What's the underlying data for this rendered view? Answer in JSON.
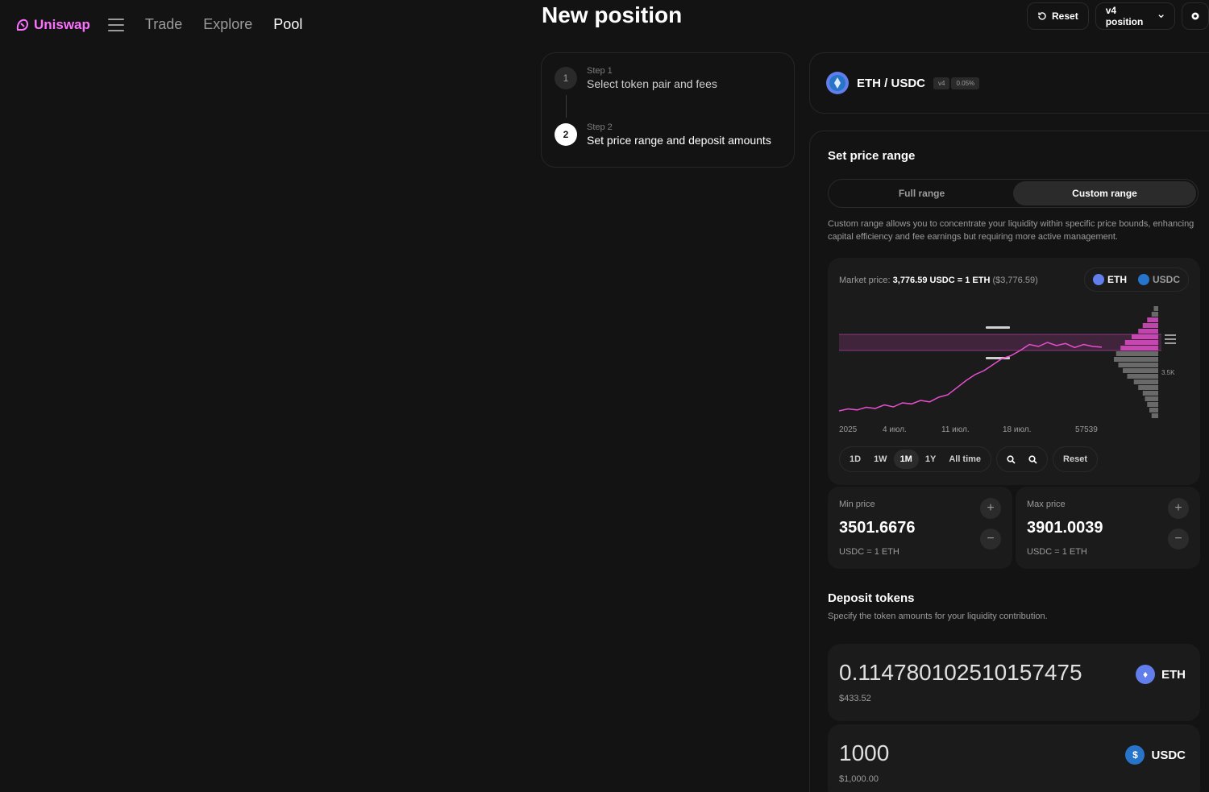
{
  "nav": {
    "brand": "Uniswap",
    "links": [
      "Trade",
      "Explore",
      "Pool"
    ],
    "active": "Pool"
  },
  "page": {
    "title": "New position"
  },
  "actions": {
    "reset": "Reset",
    "version": "v4 position"
  },
  "steps": [
    {
      "num": "1",
      "label": "Step 1",
      "title": "Select token pair and fees"
    },
    {
      "num": "2",
      "label": "Step 2",
      "title": "Set price range and deposit amounts"
    }
  ],
  "pair": {
    "name": "ETH / USDC",
    "version": "v4",
    "fee": "0.05%"
  },
  "price_range": {
    "title": "Set price range",
    "tabs": [
      "Full range",
      "Custom range"
    ],
    "active_tab": "Custom range",
    "desc": "Custom range allows you to concentrate your liquidity within specific price bounds, enhancing capital efficiency and fee earnings but requiring more active management.",
    "market_label": "Market price:",
    "market_value": "3,776.59 USDC = 1 ETH",
    "market_usd": "($3,776.59)",
    "tokens": [
      "ETH",
      "USDC"
    ],
    "x_labels": [
      "2025",
      "4 июл.",
      "11 июл.",
      "18 июл.",
      "57539"
    ],
    "y_label": "3.5K",
    "periods": [
      "1D",
      "1W",
      "1M",
      "1Y",
      "All time"
    ],
    "active_period": "1M",
    "chart_reset": "Reset",
    "min": {
      "label": "Min price",
      "value": "3501.6676",
      "unit": "USDC = 1 ETH"
    },
    "max": {
      "label": "Max price",
      "value": "3901.0039",
      "unit": "USDC = 1 ETH"
    }
  },
  "deposit": {
    "title": "Deposit tokens",
    "desc": "Specify the token amounts for your liquidity contribution.",
    "amounts": [
      {
        "value": "0.114780102510157475",
        "usd": "$433.52",
        "token": "ETH"
      },
      {
        "value": "1000",
        "usd": "$1,000.00",
        "token": "USDC"
      }
    ]
  },
  "colors": {
    "brand": "#fc72ff",
    "line": "#e84fd0",
    "eth": "#627eea",
    "usdc": "#2775ca"
  },
  "chart_data": {
    "type": "line",
    "x_ticks": [
      "2025",
      "4 июл.",
      "11 июл.",
      "18 июл.",
      "57539"
    ],
    "series": [
      {
        "values": [
          3460,
          3470,
          3465,
          3478,
          3472,
          3490,
          3480,
          3500,
          3495,
          3512,
          3505,
          3528,
          3540,
          3575,
          3610,
          3640,
          3660,
          3690,
          3720,
          3735,
          3760,
          3790,
          3780,
          3800,
          3785,
          3795,
          3775,
          3790,
          3780,
          3776.59
        ]
      }
    ],
    "range_min": 3501.6676,
    "range_max": 3901.0039,
    "liquidity_bars": [
      0.1,
      0.15,
      0.25,
      0.35,
      0.45,
      0.6,
      0.75,
      0.85,
      0.95,
      1.0,
      0.9,
      0.8,
      0.7,
      0.55,
      0.45,
      0.35,
      0.3,
      0.25,
      0.2,
      0.15
    ]
  }
}
